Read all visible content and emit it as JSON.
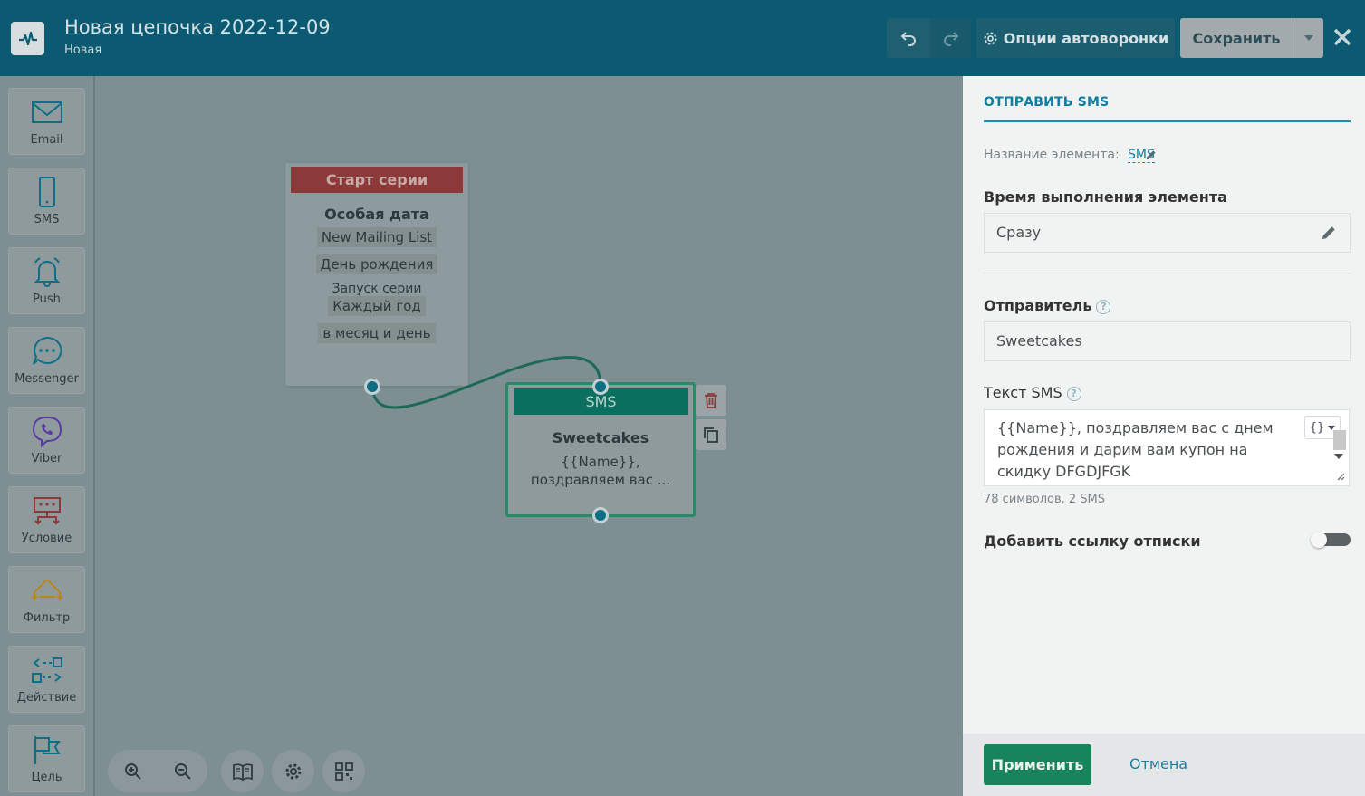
{
  "header": {
    "title": "Новая цепочка 2022-12-09",
    "subtitle": "Новая",
    "options_label": "Опции автоворонки",
    "save_label": "Сохранить",
    "bg_color": "#0b5a72"
  },
  "sidebar": {
    "items": [
      {
        "label": "Email",
        "icon": "email-icon"
      },
      {
        "label": "SMS",
        "icon": "phone-icon"
      },
      {
        "label": "Push",
        "icon": "bell-icon"
      },
      {
        "label": "Messenger",
        "icon": "chat-icon"
      },
      {
        "label": "Viber",
        "icon": "viber-icon"
      },
      {
        "label": "Условие",
        "icon": "condition-icon"
      },
      {
        "label": "Фильтр",
        "icon": "filter-icon"
      },
      {
        "label": "Действие",
        "icon": "action-icon"
      },
      {
        "label": "Цель",
        "icon": "flag-icon"
      }
    ]
  },
  "canvas": {
    "start_node": {
      "header": "Старт серии",
      "title": "Особая дата",
      "tag_list": "New Mailing List",
      "tag_field": "День рождения",
      "launch_label": "Запуск серии",
      "tag_repeat": "Каждый год",
      "tag_when": "в месяц и день"
    },
    "sms_node": {
      "header": "SMS",
      "sender": "Sweetcakes",
      "preview": "{{Name}}, поздравляем вас ..."
    }
  },
  "panel": {
    "title": "ОТПРАВИТЬ SMS",
    "name_label": "Название элемента:",
    "name_value": "SMS",
    "time_label": "Время выполнения элемента",
    "time_value": "Сразу",
    "sender_label": "Отправитель",
    "sender_value": "Sweetcakes",
    "text_label": "Текст SMS",
    "text_value": "{{Name}}, поздравляем вас с днем рождения и дарим вам купон на скидку DFGDJFGK",
    "var_button": "{}",
    "counter": "78 символов, 2 SMS",
    "unsubscribe_label": "Добавить ссылку отписки",
    "unsubscribe_on": false,
    "apply_label": "Применить",
    "cancel_label": "Отмена"
  }
}
